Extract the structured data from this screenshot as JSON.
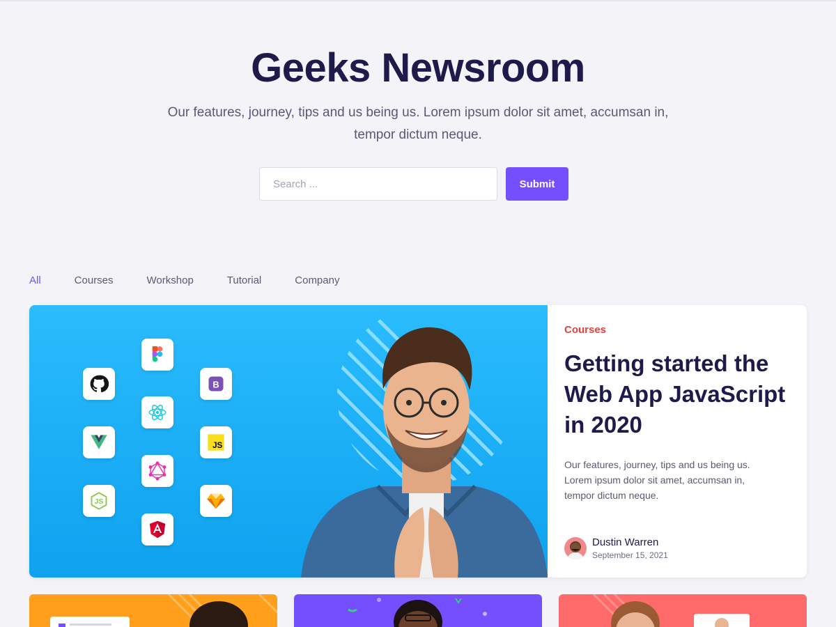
{
  "header": {
    "title": "Geeks Newsroom",
    "subtitle": "Our features, journey, tips and us being us. Lorem ipsum dolor sit amet, accumsan in, tempor dictum neque."
  },
  "search": {
    "placeholder": "Search ...",
    "submit_label": "Submit"
  },
  "tabs": [
    {
      "label": "All",
      "active": true
    },
    {
      "label": "Courses",
      "active": false
    },
    {
      "label": "Workshop",
      "active": false
    },
    {
      "label": "Tutorial",
      "active": false
    },
    {
      "label": "Company",
      "active": false
    }
  ],
  "featured": {
    "category": "Courses",
    "title": "Getting started the Web App JavaScript in 2020",
    "excerpt": "Our features, journey, tips and us being us. Lorem ipsum dolor sit amet, accumsan in, tempor dictum neque.",
    "author": "Dustin Warren",
    "date": "September 15, 2021",
    "icons": [
      "github-icon",
      "figma-icon",
      "bootstrap-icon",
      "react-icon",
      "vue-icon",
      "javascript-icon",
      "graphql-icon",
      "nodejs-icon",
      "sketch-icon",
      "angular-icon"
    ]
  },
  "cards": [
    {
      "image_color": "#ff9f1c"
    },
    {
      "image_color": "#754ffe"
    },
    {
      "image_color": "#ff6b6b"
    }
  ],
  "colors": {
    "accent": "#754ffe",
    "category": "#e53f3c",
    "feature_bg": "#19b0f8"
  }
}
